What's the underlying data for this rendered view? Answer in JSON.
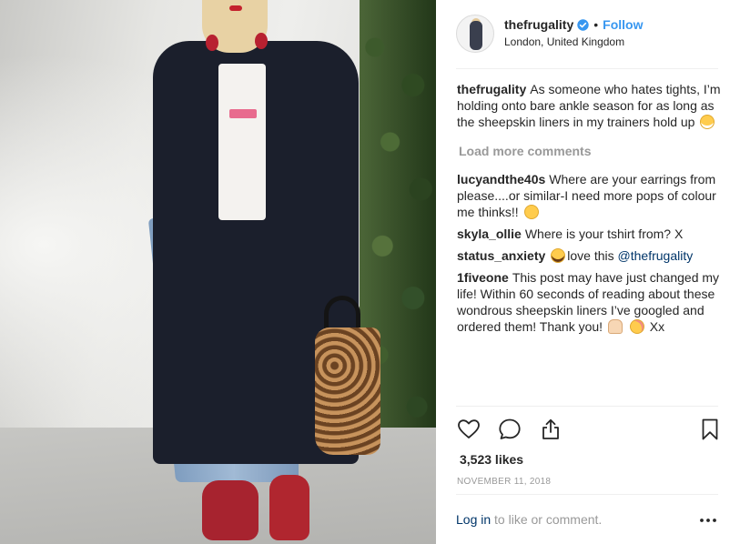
{
  "post": {
    "photo_alt": "",
    "header": {
      "username": "thefrugality",
      "verified_icon": "verified-badge-icon",
      "separator": "•",
      "follow_label": "Follow",
      "location": "London, United Kingdom"
    },
    "caption": {
      "author": "thefrugality",
      "text": "As someone who hates tights, I’m holding onto bare ankle season for as long as the sheepskin liners in my trainers hold up"
    },
    "load_more_label": "Load more comments",
    "comments": [
      {
        "author": "lucyandthe40s",
        "text": "Where are your earrings from please....or similar-I need more pops of colour me thinks!!"
      },
      {
        "author": "skyla_ollie",
        "text": "Where is your tshirt from? X"
      },
      {
        "author": "status_anxiety",
        "text": "love this",
        "mention": "@thefrugality"
      },
      {
        "author": "1fiveone",
        "text": "This post may have just changed my life! Within 60 seconds of reading about these wondrous sheepskin liners I’ve googled and ordered them! Thank you!",
        "text_end": "Xx"
      }
    ],
    "actions": {
      "like_icon": "heart-icon",
      "comment_icon": "comment-bubble-icon",
      "share_icon": "share-icon",
      "save_icon": "bookmark-icon"
    },
    "likes_text": "3,523 likes",
    "date": "NOVEMBER 11, 2018",
    "login": {
      "link_label": "Log in",
      "rest": "to like or comment.",
      "more_icon": "more-options-icon"
    }
  },
  "colors": {
    "link_blue": "#3897f0",
    "mention_navy": "#003569",
    "muted_gray": "#999999",
    "text": "#262626"
  }
}
